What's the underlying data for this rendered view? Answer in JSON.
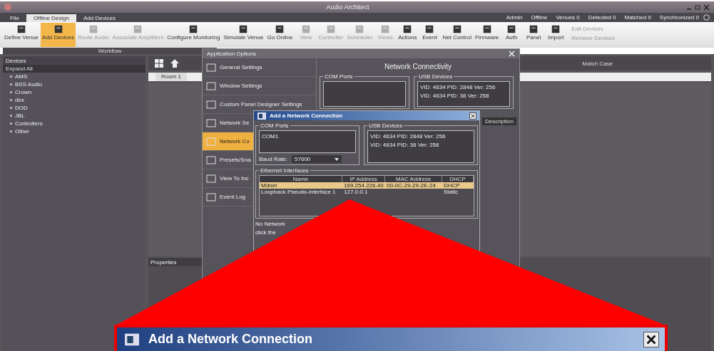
{
  "window": {
    "title": "Audio Architect"
  },
  "tabs": [
    {
      "label": "File",
      "selected": false
    },
    {
      "label": "Offline Design",
      "selected": true
    },
    {
      "label": "Add Devices",
      "selected": false
    }
  ],
  "status": [
    "Admin",
    "Offline",
    "Venues 0",
    "Detected 0",
    "Matched 0",
    "Synchronized 0"
  ],
  "ribbon": {
    "buttons": [
      {
        "label": "Define Venue",
        "selected": false,
        "disabled": false
      },
      {
        "label": "Add Devices",
        "selected": true,
        "disabled": false
      },
      {
        "label": "Route Audio",
        "selected": false,
        "disabled": true
      },
      {
        "label": "Associate Amplifiers",
        "selected": false,
        "disabled": true
      },
      {
        "label": "Configure Monitoring",
        "selected": false,
        "disabled": false
      },
      {
        "label": "Simulate Venue",
        "selected": false,
        "disabled": false
      },
      {
        "label": "Go Online",
        "selected": false,
        "disabled": false
      },
      {
        "label": "View",
        "selected": false,
        "disabled": true
      },
      {
        "label": "Controller",
        "selected": false,
        "disabled": true
      },
      {
        "label": "Scheduler",
        "selected": false,
        "disabled": true
      },
      {
        "label": "Views",
        "selected": false,
        "disabled": true
      },
      {
        "label": "Actions",
        "selected": false,
        "disabled": false
      },
      {
        "label": "Event",
        "selected": false,
        "disabled": false
      },
      {
        "label": "Net Control",
        "selected": false,
        "disabled": false
      },
      {
        "label": "Firmware",
        "selected": false,
        "disabled": false
      },
      {
        "label": "Auth",
        "selected": false,
        "disabled": false
      },
      {
        "label": "Panel",
        "selected": false,
        "disabled": false
      },
      {
        "label": "Import",
        "selected": false,
        "disabled": false
      }
    ],
    "group_label": "Workflow",
    "side_items": [
      "Edit Devices",
      "Remove Devices"
    ]
  },
  "devices": {
    "title": "Devices",
    "expand_all": "Expand All",
    "items": [
      "AMS",
      "BSS Audio",
      "Crown",
      "dbx",
      "DOD",
      "JBL",
      "Controllers",
      "Other"
    ]
  },
  "canvas": {
    "tab": "Room 1",
    "search_label": "Match Case"
  },
  "properties": {
    "title": "Properties"
  },
  "options_dialog": {
    "title": "Application Options",
    "nav": [
      {
        "label": "General Settings",
        "selected": false
      },
      {
        "label": "Window Settings",
        "selected": false
      },
      {
        "label": "Custom Panel Designer Settings",
        "selected": false
      },
      {
        "label": "Network Se",
        "selected": false
      },
      {
        "label": "Network Co",
        "selected": true
      },
      {
        "label": "Presets/Sna",
        "selected": false
      },
      {
        "label": "View To Inc",
        "selected": false
      },
      {
        "label": "Event Log",
        "selected": false
      }
    ],
    "heading": "Network Connectivity",
    "com_ports": "COM Ports",
    "usb_devices": "USB Devices",
    "usb_list": [
      "VID: 4634 PID: 2848 Ver: 256",
      "VID: 4634 PID: 38 Ver: 258"
    ],
    "column": "Description"
  },
  "network_dialog": {
    "title": "Add a Network Connection",
    "com_ports": "COM Ports",
    "com_list": [
      "COM1"
    ],
    "baud_label": "Baud Rate:",
    "baud_value": "57600",
    "usb_devices": "USB Devices",
    "usb_list": [
      "VID: 4634 PID: 2848 Ver: 256",
      "VID: 4634 PID: 38 Ver: 258"
    ],
    "ethernet": "Ethernet Interfaces",
    "columns": [
      "Name",
      "IP Address",
      "MAC Address",
      "DHCP"
    ],
    "rows": [
      {
        "name": "Mdnet",
        "ip": "169.254.226.40",
        "mac": "00-0C-29-29-2E-24",
        "dhcp": "DHCP",
        "selected": true
      },
      {
        "name": "Loopback Pseudo-Interface 1",
        "ip": "127.0.0.1",
        "dhcp": "Static",
        "selected": false
      }
    ],
    "note": [
      "No Network",
      "click the"
    ]
  },
  "callout": {
    "title": "Add a Network Connection"
  }
}
